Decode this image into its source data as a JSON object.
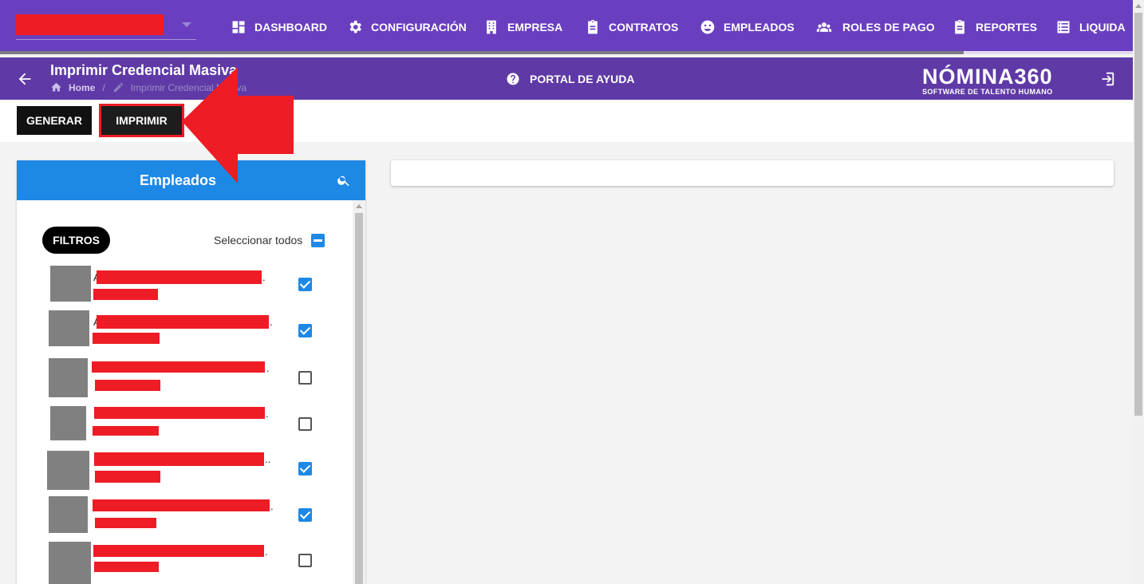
{
  "nav": {
    "items": [
      {
        "label": "DASHBOARD",
        "icon": "dashboard-icon"
      },
      {
        "label": "CONFIGURACIÓN",
        "icon": "gear-icon"
      },
      {
        "label": "EMPRESA",
        "icon": "building-icon"
      },
      {
        "label": "CONTRATOS",
        "icon": "clipboard-icon"
      },
      {
        "label": "EMPLEADOS",
        "icon": "face-icon"
      },
      {
        "label": "ROLES DE PAGO",
        "icon": "people-icon"
      },
      {
        "label": "REPORTES",
        "icon": "report-icon"
      },
      {
        "label": "LIQUIDA",
        "icon": "list-icon"
      }
    ]
  },
  "header": {
    "title": "Imprimir Credencial Masiva",
    "breadcrumb_home": "Home",
    "breadcrumb_separator": "/",
    "breadcrumb_current": "Imprimir Credencial Masiva",
    "help_label": "PORTAL DE AYUDA",
    "logo_main": "NÓMINA360",
    "logo_sub": "SOFTWARE DE TALENTO HUMANO"
  },
  "toolbar": {
    "generar_label": "GENERAR",
    "imprimir_label": "IMPRIMIR"
  },
  "employees_panel": {
    "title": "Empleados",
    "filtros_label": "FILTROS",
    "select_all_label": "Seleccionar todos",
    "employees": [
      {
        "name_prefix": "A",
        "name_suffix": ".",
        "checked": true
      },
      {
        "name_prefix": "A",
        "name_suffix": ".",
        "checked": true
      },
      {
        "name_prefix": "",
        "name_suffix": ".",
        "checked": false
      },
      {
        "name_prefix": "",
        "name_suffix": ".",
        "checked": false
      },
      {
        "name_prefix": "",
        "name_suffix": "..",
        "checked": true
      },
      {
        "name_prefix": "",
        "name_suffix": ".",
        "checked": true
      },
      {
        "name_prefix": "",
        "name_suffix": ".",
        "checked": false
      }
    ]
  },
  "colors": {
    "nav_bg": "#6a3fbf",
    "header_bg": "#5f3aa6",
    "panel_header_bg": "#1e88e5",
    "annotation_red": "#ee1c25"
  }
}
